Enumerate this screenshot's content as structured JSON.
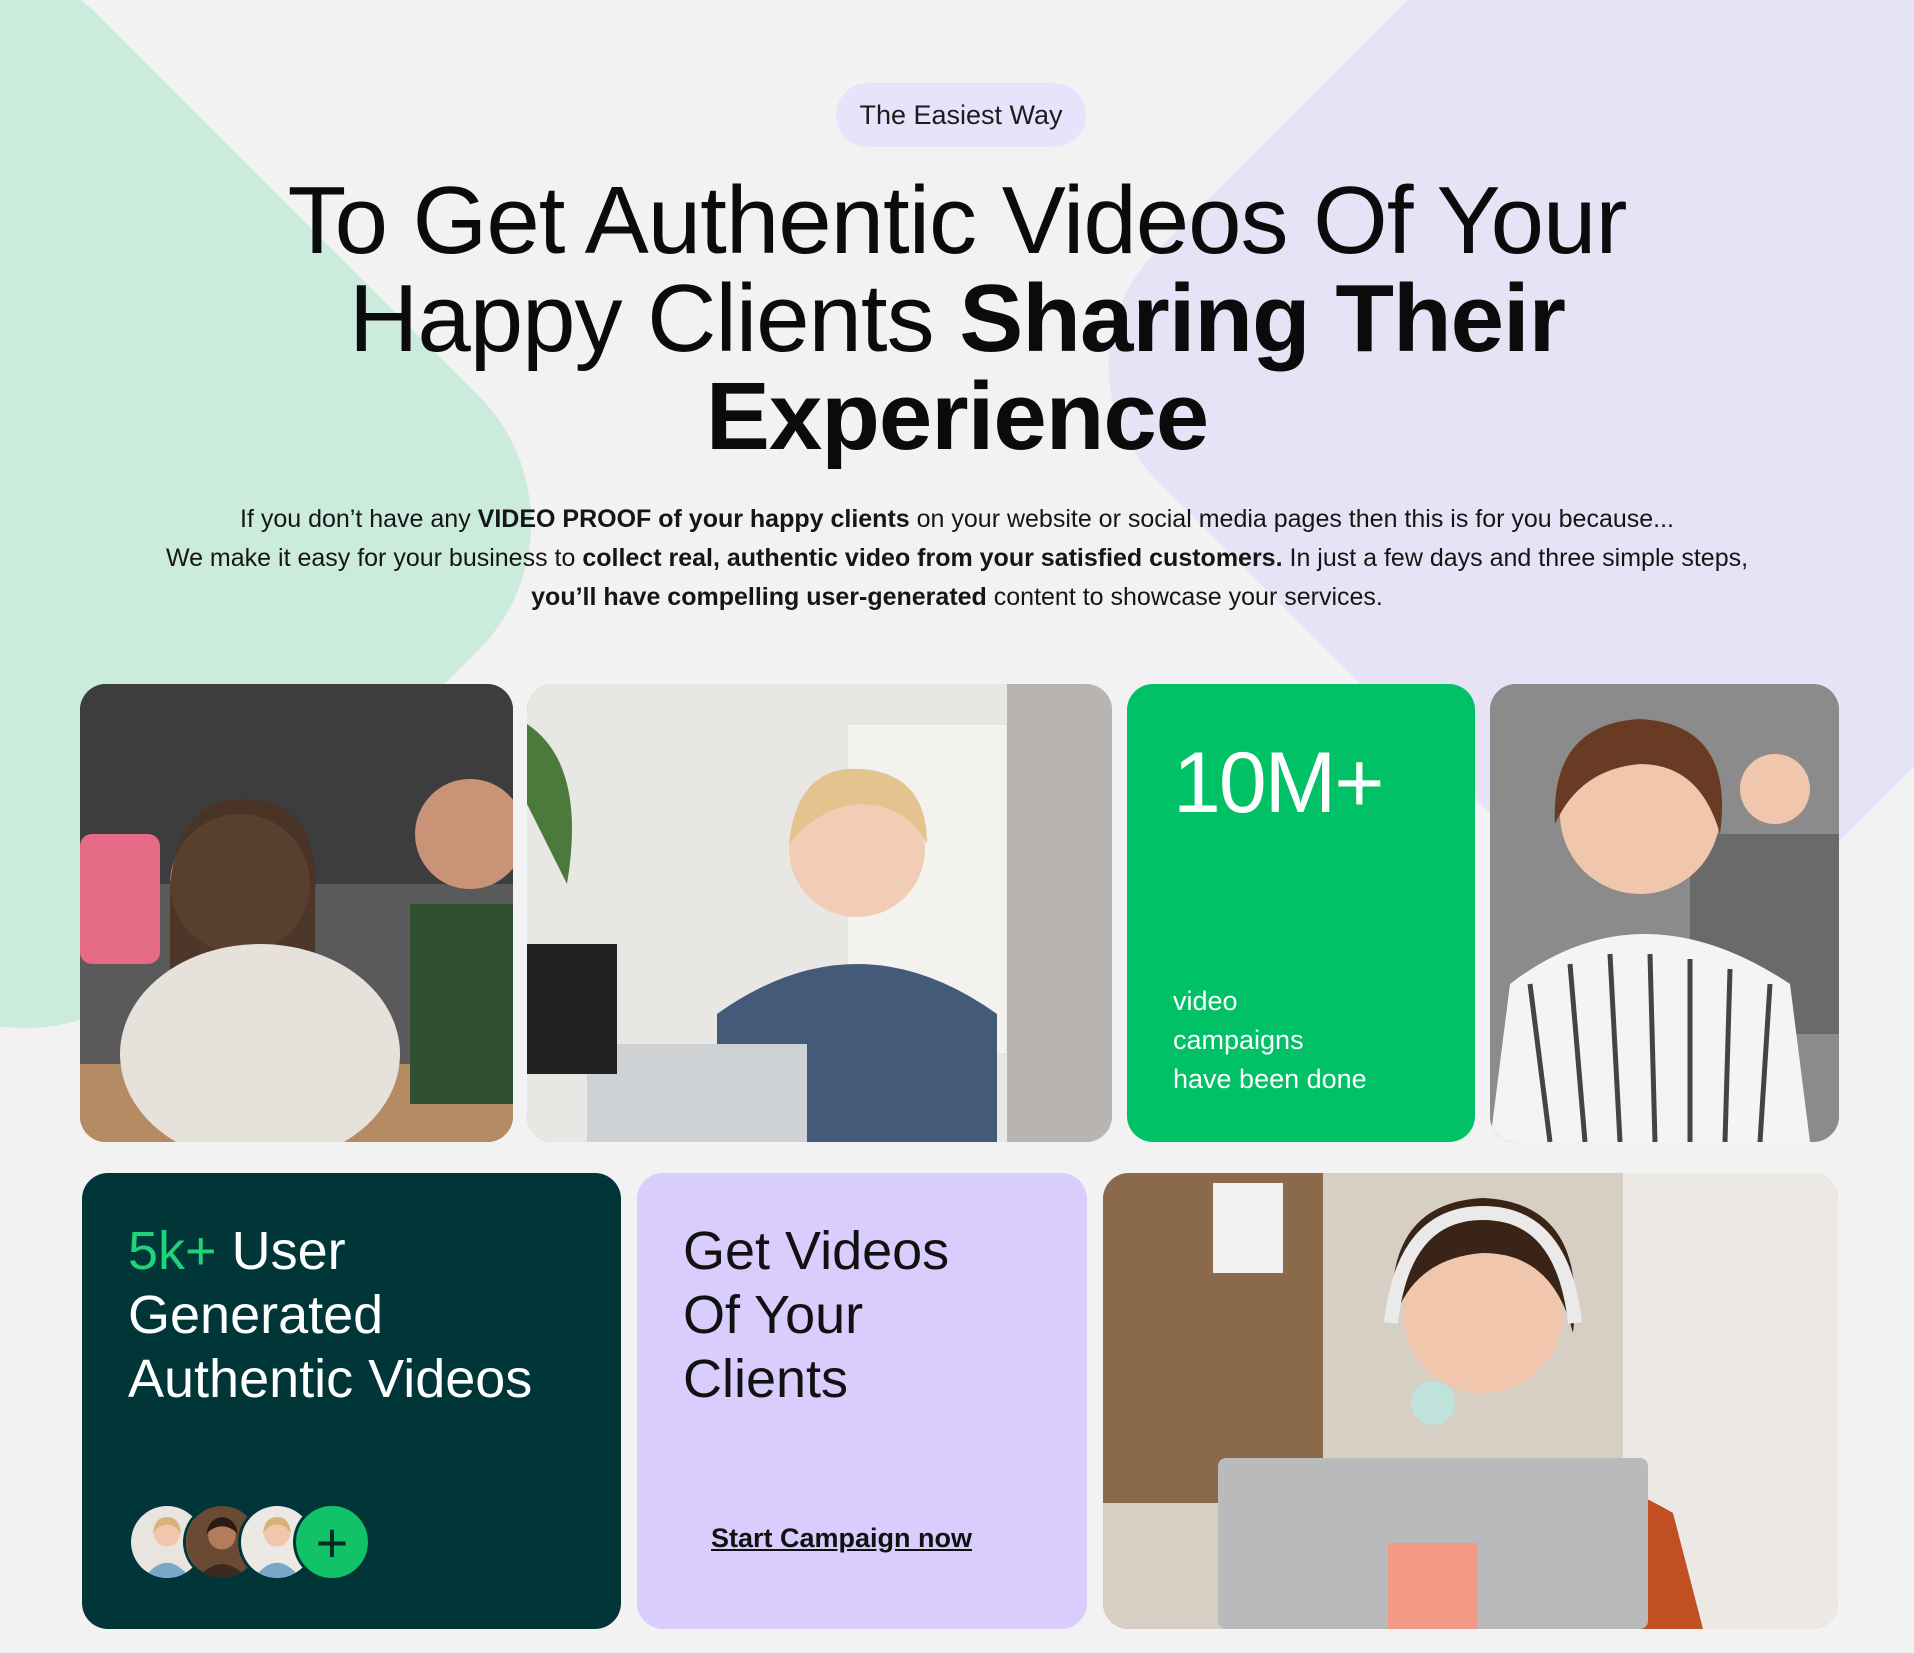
{
  "hero": {
    "badge": "The Easiest Way",
    "headline_line1": "To Get Authentic Videos Of Your",
    "headline_line2_regular": "Happy Clients ",
    "headline_line2_bold": "Sharing Their",
    "headline_line3_bold": "Experience",
    "intro": {
      "p1_a": "If you don’t have any ",
      "p1_b": "VIDEO PROOF of your happy clients",
      "p1_c": " on your website or social media pages then this is for you because...",
      "p2_a": "We make it easy for your business to ",
      "p2_b": "collect real, authentic video from your satisfied customers.",
      "p2_c": " In just a few days and three simple steps, ",
      "p2_d": "you’ll have compelling user-generated",
      "p2_e": " content to showcase your services."
    }
  },
  "stats": {
    "big": "10M+",
    "line1": "video",
    "line2": "campaigns",
    "line3": "have been done"
  },
  "ugc": {
    "accent": "5k+",
    "title_rest": " User",
    "line2": "Generated",
    "line3": "Authentic Videos",
    "plus": "+"
  },
  "cta_card": {
    "line1": "Get Videos",
    "line2": "Of Your",
    "line3": "Clients",
    "cta": "Start Campaign now"
  },
  "colors": {
    "green": "#00c166",
    "dark_teal": "#013639",
    "lilac": "#d9cdfd",
    "accent_green": "#1fd37a"
  }
}
